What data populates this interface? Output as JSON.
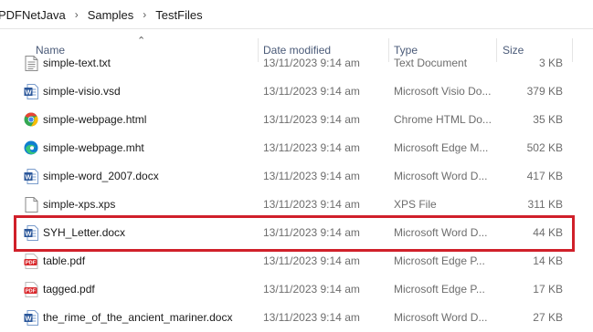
{
  "breadcrumb": [
    "PDFNetJava",
    "Samples",
    "TestFiles"
  ],
  "columns": {
    "name": "Name",
    "date": "Date modified",
    "type": "Type",
    "size": "Size"
  },
  "rows": [
    {
      "icon": "text-file-icon",
      "name": "simple-text.txt",
      "date": "13/11/2023 9:14 am",
      "type": "Text Document",
      "size": "3 KB"
    },
    {
      "icon": "visio-file-icon",
      "name": "simple-visio.vsd",
      "date": "13/11/2023 9:14 am",
      "type": "Microsoft Visio Do...",
      "size": "379 KB"
    },
    {
      "icon": "chrome-icon",
      "name": "simple-webpage.html",
      "date": "13/11/2023 9:14 am",
      "type": "Chrome HTML Do...",
      "size": "35 KB"
    },
    {
      "icon": "edge-icon",
      "name": "simple-webpage.mht",
      "date": "13/11/2023 9:14 am",
      "type": "Microsoft Edge M...",
      "size": "502 KB"
    },
    {
      "icon": "word-file-icon",
      "name": "simple-word_2007.docx",
      "date": "13/11/2023 9:14 am",
      "type": "Microsoft Word D...",
      "size": "417 KB"
    },
    {
      "icon": "blank-file-icon",
      "name": "simple-xps.xps",
      "date": "13/11/2023 9:14 am",
      "type": "XPS File",
      "size": "311 KB"
    },
    {
      "icon": "word-file-icon",
      "name": "SYH_Letter.docx",
      "date": "13/11/2023 9:14 am",
      "type": "Microsoft Word D...",
      "size": "44 KB"
    },
    {
      "icon": "pdf-file-icon",
      "name": "table.pdf",
      "date": "13/11/2023 9:14 am",
      "type": "Microsoft Edge P...",
      "size": "14 KB"
    },
    {
      "icon": "pdf-file-icon",
      "name": "tagged.pdf",
      "date": "13/11/2023 9:14 am",
      "type": "Microsoft Edge P...",
      "size": "17 KB"
    },
    {
      "icon": "word-file-icon",
      "name": "the_rime_of_the_ancient_mariner.docx",
      "date": "13/11/2023 9:14 am",
      "type": "Microsoft Word D...",
      "size": "27 KB"
    }
  ],
  "colors": {
    "highlight": "#d0202a",
    "word": "#2b579a",
    "pdf": "#d9262a",
    "chrome_red": "#ea4335",
    "edge": "#0f7fd0"
  }
}
